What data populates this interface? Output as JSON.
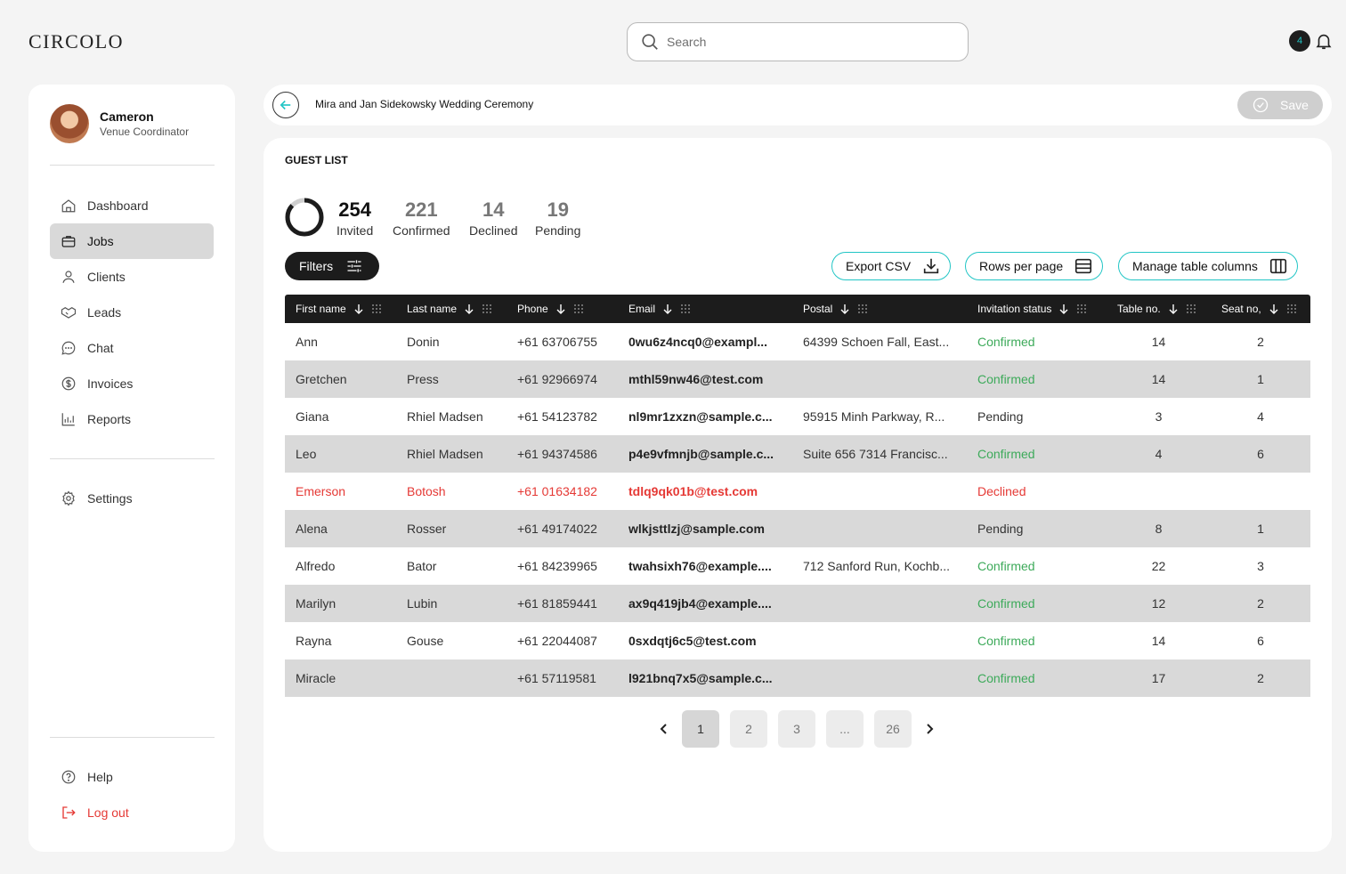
{
  "app": {
    "logo": "CIRCOLO"
  },
  "search": {
    "placeholder": "Search"
  },
  "notifications": {
    "count": "4"
  },
  "user": {
    "name": "Cameron",
    "role": "Venue Coordinator"
  },
  "sidebar": {
    "items": [
      {
        "label": "Dashboard",
        "icon": "home-icon"
      },
      {
        "label": "Jobs",
        "icon": "briefcase-icon",
        "active": true
      },
      {
        "label": "Clients",
        "icon": "user-icon"
      },
      {
        "label": "Leads",
        "icon": "handshake-icon"
      },
      {
        "label": "Chat",
        "icon": "chat-icon"
      },
      {
        "label": "Invoices",
        "icon": "dollar-icon"
      },
      {
        "label": "Reports",
        "icon": "bar-chart-icon"
      }
    ],
    "settings": "Settings",
    "help": "Help",
    "logout": "Log out"
  },
  "event": {
    "title": "Mira and Jan Sidekowsky Wedding Ceremony",
    "save_label": "Save"
  },
  "guest_list": {
    "title": "GUEST LIST",
    "stats": [
      {
        "value": "254",
        "label": "Invited"
      },
      {
        "value": "221",
        "label": "Confirmed"
      },
      {
        "value": "14",
        "label": "Declined"
      },
      {
        "value": "19",
        "label": "Pending"
      }
    ],
    "confirmed_fraction": 0.87
  },
  "toolbar": {
    "filters": "Filters",
    "export_csv": "Export CSV",
    "rows_per_page": "Rows per page",
    "manage_columns": "Manage table columns"
  },
  "table": {
    "columns": [
      "First name",
      "Last name",
      "Phone",
      "Email",
      "Postal",
      "Invitation status",
      "Table no.",
      "Seat no,"
    ],
    "rows": [
      {
        "first": "Ann",
        "last": "Donin",
        "phone": "+61 63706755",
        "email": "0wu6z4ncq0@exampl...",
        "postal": "64399 Schoen Fall, East...",
        "status": "Confirmed",
        "table": "14",
        "seat": "2"
      },
      {
        "first": "Gretchen",
        "last": "Press",
        "phone": "+61 92966974",
        "email": "mthl59nw46@test.com",
        "postal": "",
        "status": "Confirmed",
        "table": "14",
        "seat": "1"
      },
      {
        "first": "Giana",
        "last": "Rhiel Madsen",
        "phone": "+61 54123782",
        "email": "nl9mr1zxzn@sample.c...",
        "postal": "95915 Minh Parkway, R...",
        "status": "Pending",
        "table": "3",
        "seat": "4"
      },
      {
        "first": "Leo",
        "last": "Rhiel Madsen",
        "phone": "+61 94374586",
        "email": "p4e9vfmnjb@sample.c...",
        "postal": "Suite 656 7314 Francisc...",
        "status": "Confirmed",
        "table": "4",
        "seat": "6"
      },
      {
        "first": "Emerson",
        "last": "Botosh",
        "phone": "+61 01634182",
        "email": "tdlq9qk01b@test.com",
        "postal": "",
        "status": "Declined",
        "table": "",
        "seat": ""
      },
      {
        "first": "Alena",
        "last": "Rosser",
        "phone": "+61 49174022",
        "email": "wlkjsttlzj@sample.com",
        "postal": "",
        "status": "Pending",
        "table": "8",
        "seat": "1"
      },
      {
        "first": "Alfredo",
        "last": "Bator",
        "phone": "+61 84239965",
        "email": "twahsixh76@example....",
        "postal": "712 Sanford Run, Kochb...",
        "status": "Confirmed",
        "table": "22",
        "seat": "3"
      },
      {
        "first": "Marilyn",
        "last": "Lubin",
        "phone": "+61 81859441",
        "email": "ax9q419jb4@example....",
        "postal": "",
        "status": "Confirmed",
        "table": "12",
        "seat": "2"
      },
      {
        "first": "Rayna",
        "last": "Gouse",
        "phone": "+61 22044087",
        "email": "0sxdqtj6c5@test.com",
        "postal": "",
        "status": "Confirmed",
        "table": "14",
        "seat": "6"
      },
      {
        "first": "Miracle",
        "last": "",
        "phone": "+61 57119581",
        "email": "l921bnq7x5@sample.c...",
        "postal": "",
        "status": "Confirmed",
        "table": "17",
        "seat": "2"
      }
    ]
  },
  "pagination": {
    "pages": [
      "1",
      "2",
      "3",
      "...",
      "26"
    ],
    "current": "1"
  },
  "colors": {
    "accent": "#21c5c5",
    "confirmed": "#3daa5a",
    "declined": "#e53935",
    "dark": "#1c1c1c"
  }
}
